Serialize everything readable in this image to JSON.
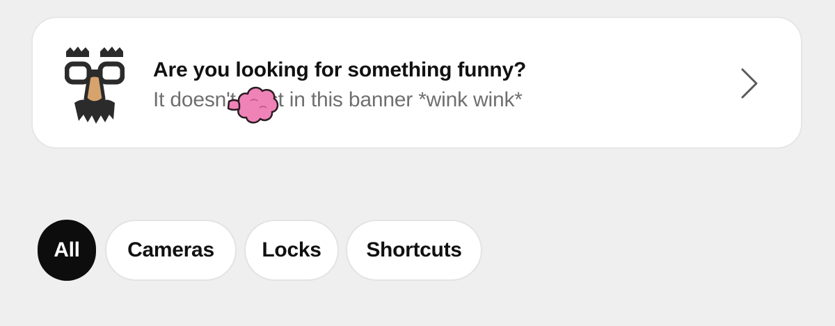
{
  "banner": {
    "icon": "groucho-glasses-disguise-icon",
    "title": "Are you looking for something funny?",
    "subtitle": "It doesn't exist in this banner *wink wink*",
    "overlay_icon": "pink-fart-cloud-icon",
    "action_icon": "chevron-right-icon",
    "colors": {
      "background": "#ffffff",
      "title": "#111111",
      "subtitle": "#6f6f6f",
      "cloud": "#ef83b8"
    }
  },
  "filters": {
    "chips": [
      {
        "label": "All",
        "selected": true
      },
      {
        "label": "Cameras",
        "selected": false
      },
      {
        "label": "Locks",
        "selected": false
      },
      {
        "label": "Shortcuts",
        "selected": false
      }
    ],
    "colors": {
      "selected_background": "#0d0d0d",
      "selected_text": "#ffffff",
      "unselected_background": "#ffffff",
      "unselected_text": "#111111"
    }
  }
}
